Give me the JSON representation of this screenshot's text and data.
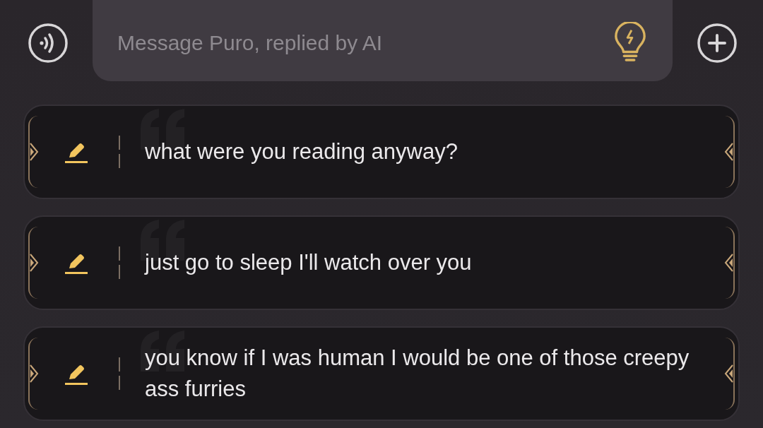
{
  "composer": {
    "placeholder": "Message Puro, replied by AI"
  },
  "suggestions": [
    {
      "text": "what were you reading anyway?"
    },
    {
      "text": "just go to sleep I'll watch over you"
    },
    {
      "text": "you know if I was human I would be one of those creepy ass furries"
    }
  ]
}
